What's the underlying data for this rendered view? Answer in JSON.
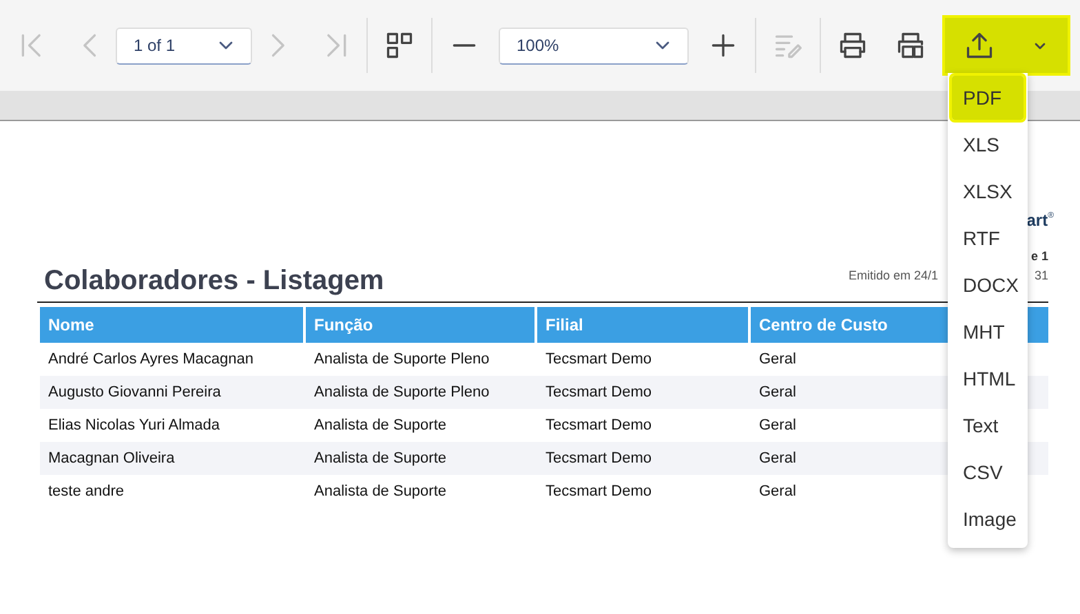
{
  "toolbar": {
    "nav_buttons": [
      {
        "kind": "first",
        "disabled": true
      },
      {
        "kind": "prev",
        "disabled": true
      },
      {
        "kind": "page",
        "value": "1 of 1"
      },
      {
        "kind": "next",
        "disabled": true
      },
      {
        "kind": "last",
        "disabled": true
      }
    ],
    "zoom": {
      "value": "100%"
    },
    "edit_disabled": true
  },
  "export_menu": {
    "open": true,
    "items": [
      {
        "label": "PDF",
        "selected": true
      },
      {
        "label": "XLS",
        "selected": false
      },
      {
        "label": "XLSX",
        "selected": false
      },
      {
        "label": "RTF",
        "selected": false
      },
      {
        "label": "DOCX",
        "selected": false
      },
      {
        "label": "MHT",
        "selected": false
      },
      {
        "label": "HTML",
        "selected": false
      },
      {
        "label": "Text",
        "selected": false
      },
      {
        "label": "CSV",
        "selected": false
      },
      {
        "label": "Image",
        "selected": false
      }
    ]
  },
  "report": {
    "logo_fragment": "art",
    "logo_mark": "®",
    "page_fragment": "e 1",
    "issued_fragment": "Emitido em 24/1",
    "time_fragment": "31",
    "title": "Colaboradores - Listagem",
    "columns": [
      "Nome",
      "Função",
      "Filial",
      "Centro de Custo"
    ],
    "rows": [
      [
        "André Carlos Ayres Macagnan",
        "Analista de Suporte Pleno",
        "Tecsmart Demo",
        "Geral"
      ],
      [
        "Augusto Giovanni Pereira",
        "Analista de Suporte Pleno",
        "Tecsmart Demo",
        "Geral"
      ],
      [
        "Elias Nicolas Yuri Almada",
        "Analista de Suporte",
        "Tecsmart Demo",
        "Geral"
      ],
      [
        "Macagnan Oliveira",
        "Analista de Suporte",
        "Tecsmart Demo",
        "Geral"
      ],
      [
        "teste andre",
        "Analista de Suporte",
        "Tecsmart Demo",
        "Geral"
      ]
    ]
  }
}
